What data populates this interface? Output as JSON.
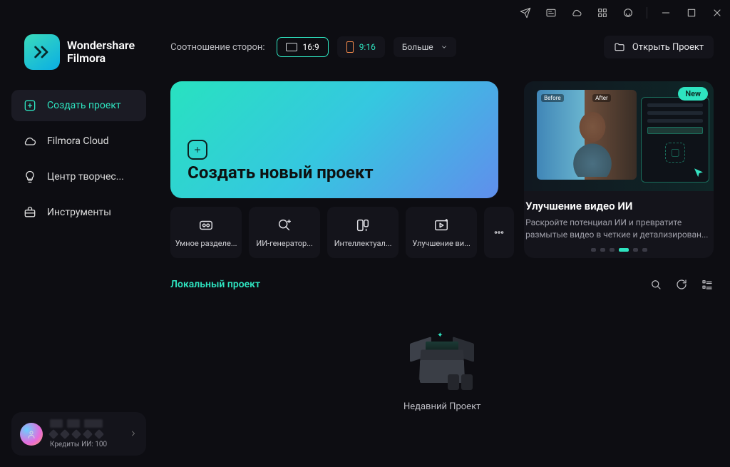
{
  "brand": {
    "line1": "Wondershare",
    "line2": "Filmora"
  },
  "nav": {
    "create": "Создать проект",
    "cloud": "Filmora Cloud",
    "creative_center": "Центр творчес...",
    "tools": "Инструменты"
  },
  "footer": {
    "credits_prefix": "Кредиты ИИ:",
    "credits_value": "100"
  },
  "topbar": {
    "ratio_label": "Соотношение сторон:",
    "ratio_16_9": "16:9",
    "ratio_9_16": "9:16",
    "more": "Больше",
    "open_project": "Открыть Проект"
  },
  "hero": {
    "create_title": "Создать новый проект",
    "feature_badge": "New",
    "feature_title": "Улучшение видео ИИ",
    "feature_desc": "Раскройте потенциал ИИ и превратите размытые видео в четкие и детализирован..."
  },
  "tools_row": {
    "t1": "Умное разделе...",
    "t2": "ИИ-генератор...",
    "t3": "Интеллектуал...",
    "t4": "Улучшение ви..."
  },
  "local": {
    "title": "Локальный проект",
    "recent_label": "Недавний Проект"
  }
}
